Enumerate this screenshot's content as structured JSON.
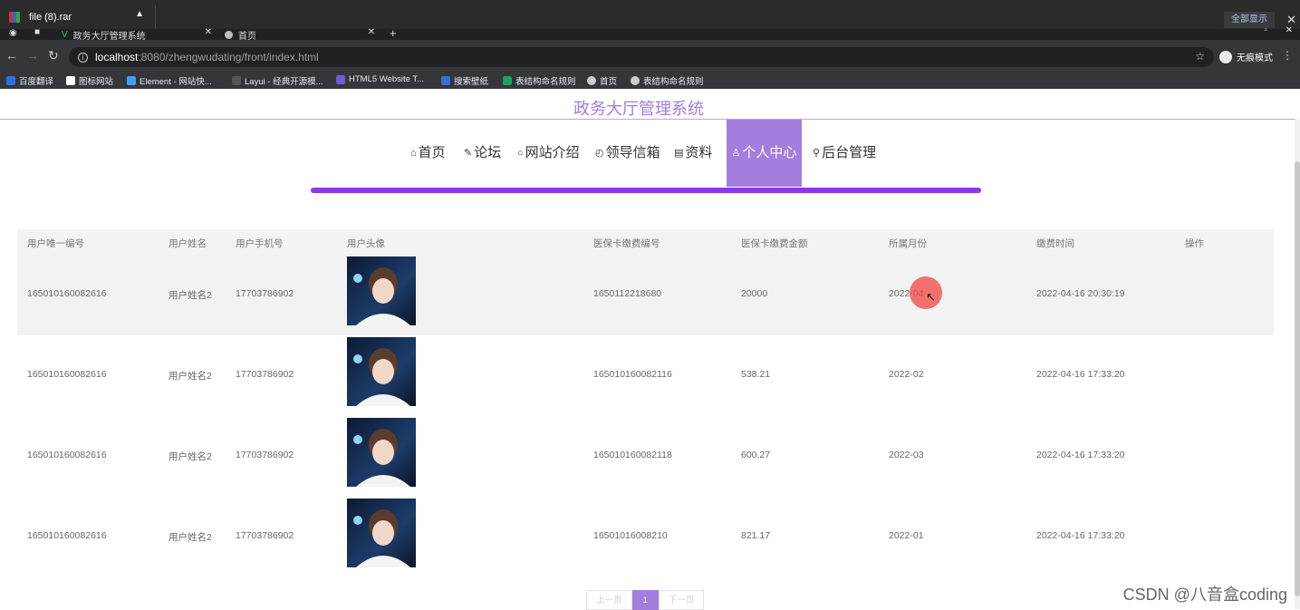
{
  "download_bar": {
    "file_name": "file (8).rar",
    "show_all": "全部显示"
  },
  "tabs": [
    {
      "title": "政务大厅管理系统",
      "active": false
    },
    {
      "title": "首页",
      "active": true
    }
  ],
  "address_bar": {
    "host": "localhost",
    "rest": ":8080/zhengwudating/front/index.html",
    "incognito_label": "无痕模式"
  },
  "bookmarks": [
    {
      "label": "百度翻译",
      "color": "#2f6fe4"
    },
    {
      "label": "图标网站",
      "color": "#ffffff"
    },
    {
      "label": "Element - 网站快...",
      "color": "#409eff"
    },
    {
      "label": "Layui - 经典开源模...",
      "color": "#cccccc"
    },
    {
      "label": "HTML5 Website T...",
      "color": "#6b5bd6"
    },
    {
      "label": "搜索壁纸",
      "color": "#3a6fd8"
    },
    {
      "label": "表结构命名规则",
      "color": "#1aa260"
    },
    {
      "label": "首页",
      "color": "#cccccc"
    },
    {
      "label": "表结构命名规则",
      "color": "#cccccc"
    }
  ],
  "site": {
    "title": "政务大厅管理系统",
    "nav": [
      {
        "icon": "⌂",
        "label": "首页"
      },
      {
        "icon": "✎",
        "label": "论坛"
      },
      {
        "icon": "○",
        "label": "网站介绍"
      },
      {
        "icon": "◴",
        "label": "领导信箱"
      },
      {
        "icon": "▤",
        "label": "资料"
      },
      {
        "icon": "♙",
        "label": "个人中心"
      },
      {
        "icon": "⚲",
        "label": "后台管理"
      }
    ]
  },
  "table": {
    "headers": [
      "用户唯一编号",
      "用户姓名",
      "用户手机号",
      "用户头像",
      "医保卡缴费编号",
      "医保卡缴费金额",
      "所属月份",
      "缴费时间",
      "操作"
    ],
    "rows": [
      [
        "165010160082616",
        "用户姓名2",
        "17703786902",
        "",
        "1650112218680",
        "20000",
        "2022-04",
        "2022-04-16 20:30:19",
        ""
      ],
      [
        "165010160082616",
        "用户姓名2",
        "17703786902",
        "",
        "165010160082116",
        "538.21",
        "2022-02",
        "2022-04-16 17:33:20",
        ""
      ],
      [
        "165010160082616",
        "用户姓名2",
        "17703786902",
        "",
        "165010160082118",
        "600.27",
        "2022-03",
        "2022-04-16 17:33:20",
        ""
      ],
      [
        "165010160082616",
        "用户姓名2",
        "17703786902",
        "",
        "16501016008210",
        "821.17",
        "2022-01",
        "2022-04-16 17:33:20",
        ""
      ]
    ]
  },
  "pagination": {
    "prev": "上一页",
    "current": "1",
    "next": "下一页"
  },
  "watermark": "CSDN @八音盒coding"
}
